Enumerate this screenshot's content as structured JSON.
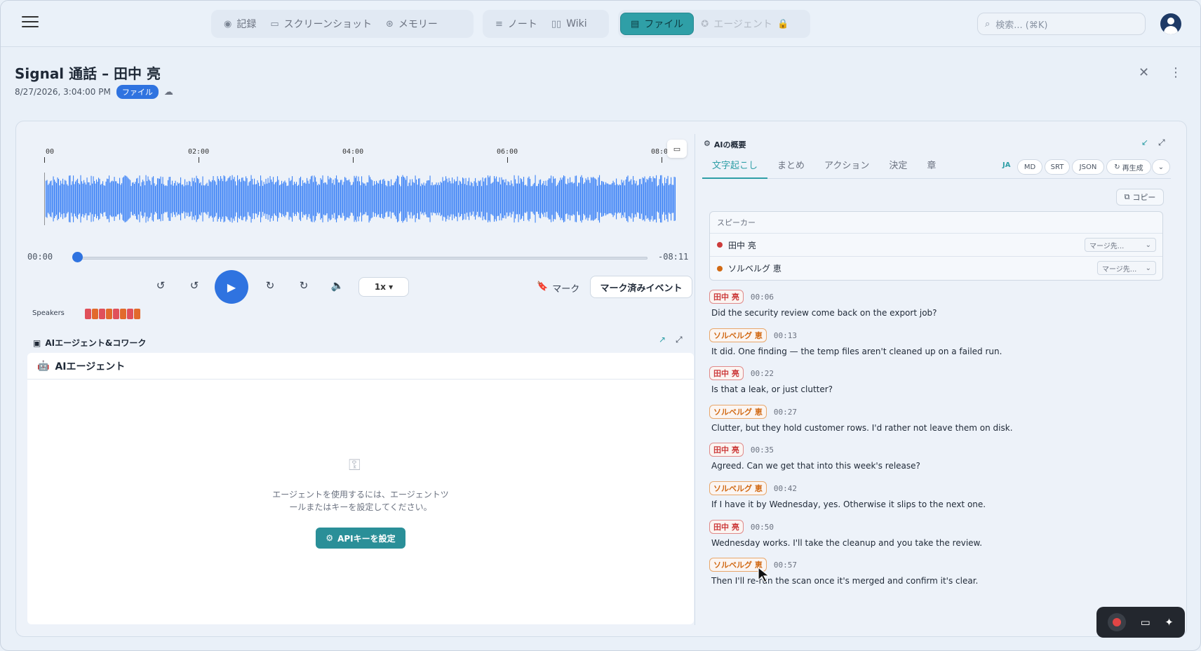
{
  "nav": {
    "groups": [
      [
        {
          "label": "記録",
          "icon": "record-icon"
        },
        {
          "label": "スクリーンショット",
          "icon": "screenshot-icon"
        },
        {
          "label": "メモリー",
          "icon": "memory-icon"
        }
      ],
      [
        {
          "label": "ノート",
          "icon": "note-icon"
        },
        {
          "label": "Wiki",
          "icon": "wiki-icon"
        }
      ],
      [
        {
          "label": "ファイル",
          "icon": "file-icon",
          "active": true
        },
        {
          "label": "エージェント",
          "icon": "agent-icon",
          "disabled": true
        }
      ]
    ],
    "search_placeholder": "検索... (⌘K)"
  },
  "header": {
    "title": "Signal 通話 – 田中 亮",
    "datetime": "8/27/2026, 3:04:00 PM",
    "badge": "ファイル"
  },
  "player": {
    "ruler": [
      "00",
      "02:00",
      "04:00",
      "06:00",
      "08:0"
    ],
    "current_time": "00:00",
    "remaining_time": "-08:11",
    "progress": 0,
    "speed": "1x ▾",
    "mark_label": "マーク",
    "marked_events_label": "マーク済みイベント",
    "speakers_label": "Speakers",
    "speaker_colors": [
      "#e0505a",
      "#e26a2c",
      "#e0505a",
      "#e26a2c",
      "#e0505a",
      "#e26a2c",
      "#e0505a",
      "#e26a2c"
    ]
  },
  "agent": {
    "section_title": "AIエージェント&コワーク",
    "panel_title": "AIエージェント",
    "message": "エージェントを使用するには、エージェントツールまたはキーを設定してください。",
    "api_button": "APIキーを設定"
  },
  "summary": {
    "title": "AIの概要",
    "tabs": [
      "文字起こし",
      "まとめ",
      "アクション",
      "決定",
      "章"
    ],
    "lang": "JA",
    "formats": [
      "MD",
      "SRT",
      "JSON"
    ],
    "regenerate": "再生成",
    "copy": "コピー",
    "speakers_header": "スピーカー",
    "speakers": [
      {
        "name": "田中 亮",
        "color": "#cc3b3b",
        "merge": "マージ先..."
      },
      {
        "name": "ソルベルグ 恵",
        "color": "#d16914",
        "merge": "マージ先..."
      }
    ],
    "segments": [
      {
        "speaker": "田中 亮",
        "cls": "r",
        "time": "00:06",
        "text": "Did the security review come back on the export job?"
      },
      {
        "speaker": "ソルベルグ 恵",
        "cls": "o",
        "time": "00:13",
        "text": "It did. One finding — the temp files aren't cleaned up on a failed run."
      },
      {
        "speaker": "田中 亮",
        "cls": "r",
        "time": "00:22",
        "text": "Is that a leak, or just clutter?"
      },
      {
        "speaker": "ソルベルグ 恵",
        "cls": "o",
        "time": "00:27",
        "text": "Clutter, but they hold customer rows. I'd rather not leave them on disk."
      },
      {
        "speaker": "田中 亮",
        "cls": "r",
        "time": "00:35",
        "text": "Agreed. Can we get that into this week's release?"
      },
      {
        "speaker": "ソルベルグ 恵",
        "cls": "o",
        "time": "00:42",
        "text": "If I have it by Wednesday, yes. Otherwise it slips to the next one."
      },
      {
        "speaker": "田中 亮",
        "cls": "r",
        "time": "00:50",
        "text": "Wednesday works. I'll take the cleanup and you take the review."
      },
      {
        "speaker": "ソルベルグ 恵",
        "cls": "o",
        "time": "00:57",
        "text": "Then I'll re-run the scan once it's merged and confirm it's clear."
      }
    ]
  }
}
